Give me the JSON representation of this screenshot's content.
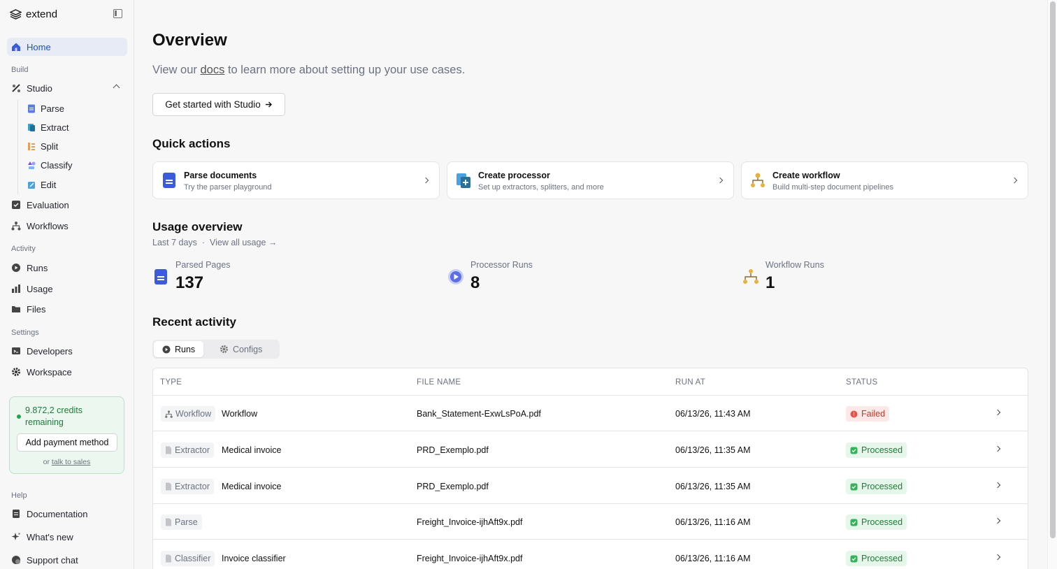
{
  "app": {
    "name": "extend"
  },
  "sidebar": {
    "home": "Home",
    "build_label": "Build",
    "studio": "Studio",
    "studio_items": [
      "Parse",
      "Extract",
      "Split",
      "Classify",
      "Edit"
    ],
    "evaluation": "Evaluation",
    "workflows": "Workflows",
    "activity_label": "Activity",
    "runs": "Runs",
    "usage": "Usage",
    "files": "Files",
    "settings_label": "Settings",
    "developers": "Developers",
    "workspace": "Workspace",
    "credits_text": "9.872,2 credits remaining",
    "add_payment": "Add payment method",
    "or_text": "or",
    "talk_to_sales": "talk to sales",
    "help_label": "Help",
    "documentation": "Documentation",
    "whats_new": "What's new",
    "support_chat": "Support chat"
  },
  "main": {
    "title": "Overview",
    "subtitle_pre": "View our",
    "subtitle_link": "docs",
    "subtitle_post": "to learn more about setting up your use cases.",
    "start_button": "Get started with Studio",
    "quick_actions_title": "Quick actions",
    "quick_actions": [
      {
        "title": "Parse documents",
        "desc": "Try the parser playground"
      },
      {
        "title": "Create processor",
        "desc": "Set up extractors, splitters, and more"
      },
      {
        "title": "Create workflow",
        "desc": "Build multi-step document pipelines"
      }
    ],
    "usage_title": "Usage overview",
    "usage_range": "Last 7 days",
    "usage_sep": "·",
    "view_all_usage": "View all usage →",
    "stats": [
      {
        "label": "Parsed Pages",
        "value": "137"
      },
      {
        "label": "Processor Runs",
        "value": "8"
      },
      {
        "label": "Workflow Runs",
        "value": "1"
      }
    ],
    "recent_title": "Recent activity",
    "tabs": [
      "Runs",
      "Configs"
    ],
    "table_headers": [
      "TYPE",
      "FILE NAME",
      "RUN AT",
      "STATUS"
    ],
    "rows": [
      {
        "type": "Workflow",
        "name": "Workflow",
        "file": "Bank_Statement-ExwLsPoA.pdf",
        "run_at": "06/13/26, 11:43 AM",
        "status": "Failed"
      },
      {
        "type": "Extractor",
        "name": "Medical invoice",
        "file": "PRD_Exemplo.pdf",
        "run_at": "06/13/26, 11:35 AM",
        "status": "Processed"
      },
      {
        "type": "Extractor",
        "name": "Medical invoice",
        "file": "PRD_Exemplo.pdf",
        "run_at": "06/13/26, 11:35 AM",
        "status": "Processed"
      },
      {
        "type": "Parse",
        "name": "",
        "file": "Freight_Invoice-ijhAft9x.pdf",
        "run_at": "06/13/26, 11:16 AM",
        "status": "Processed"
      },
      {
        "type": "Classifier",
        "name": "Invoice classifier",
        "file": "Freight_Invoice-ijhAft9x.pdf",
        "run_at": "06/13/26, 11:16 AM",
        "status": "Processed"
      }
    ]
  },
  "colors": {
    "accent": "#1d4ed8",
    "success": "#1f7a39",
    "danger": "#c0392b",
    "workflow": "#e0a030"
  }
}
